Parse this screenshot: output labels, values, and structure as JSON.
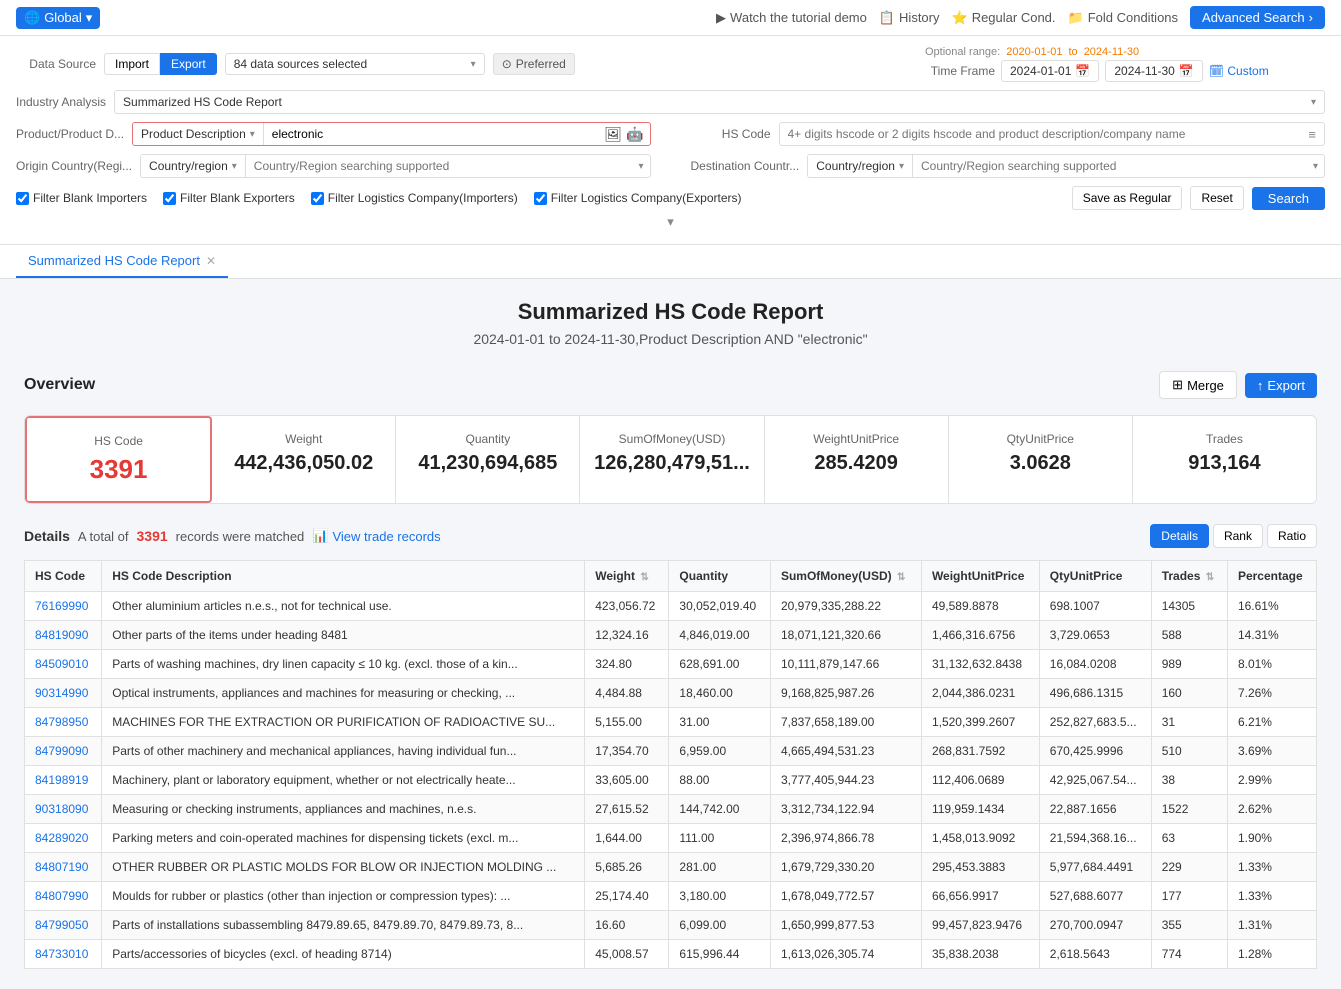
{
  "topNav": {
    "globalLabel": "Global",
    "tutorialLabel": "Watch the tutorial demo",
    "historyLabel": "History",
    "regularCondLabel": "Regular Cond.",
    "foldCondLabel": "Fold Conditions",
    "advancedSearchLabel": "Advanced Search"
  },
  "searchForm": {
    "dataSourceLabel": "Data Source",
    "importLabel": "Import",
    "exportLabel": "Export",
    "dataSourcesSelected": "84 data sources selected",
    "preferredLabel": "Preferred",
    "optionalRange": "Optional range:",
    "dateRangeStart": "2020-01-01",
    "dateRangeEnd": "2024-11-30",
    "timeFrameLabel": "Time Frame",
    "timeFrameStart": "2024-01-01",
    "timeFrameEnd": "2024-11-30",
    "customLabel": "Custom",
    "industryAnalysisLabel": "Industry Analysis",
    "industryValue": "Summarized HS Code Report",
    "productLabel": "Product/Product D...",
    "productTypeLabel": "Product Description",
    "productValue": "electronic",
    "hsCodeLabel": "HS Code",
    "hsCodePlaceholder": "4+ digits hscode or 2 digits hscode and product description/company name",
    "originCountryLabel": "Origin Country(Regi...",
    "originCountryType": "Country/region",
    "originCountryPlaceholder": "Country/Region searching supported",
    "destCountryLabel": "Destination Countr...",
    "destCountryType": "Country/region",
    "destCountryPlaceholder": "Country/Region searching supported",
    "checkboxes": [
      "Filter Blank Importers",
      "Filter Blank Exporters",
      "Filter Logistics Company(Importers)",
      "Filter Logistics Company(Exporters)"
    ],
    "saveRegularLabel": "Save as Regular",
    "resetLabel": "Reset",
    "searchLabel": "Search"
  },
  "resultTab": {
    "label": "Summarized HS Code Report"
  },
  "report": {
    "title": "Summarized HS Code Report",
    "subtitle": "2024-01-01 to 2024-11-30,Product Description AND \"electronic\""
  },
  "overview": {
    "title": "Overview",
    "mergeLabel": "Merge",
    "exportLabel": "Export",
    "stats": [
      {
        "label": "HS Code",
        "value": "3391",
        "highlight": true
      },
      {
        "label": "Weight",
        "value": "442,436,050.02"
      },
      {
        "label": "Quantity",
        "value": "41,230,694,685"
      },
      {
        "label": "SumOfMoney(USD)",
        "value": "126,280,479,51..."
      },
      {
        "label": "WeightUnitPrice",
        "value": "285.4209"
      },
      {
        "label": "QtyUnitPrice",
        "value": "3.0628"
      },
      {
        "label": "Trades",
        "value": "913,164"
      }
    ]
  },
  "details": {
    "title": "Details",
    "totalPrefix": "A total of",
    "totalCount": "3391",
    "totalSuffix": "records were matched",
    "viewTradeLabel": "View trade records",
    "tabs": [
      "Details",
      "Rank",
      "Ratio"
    ],
    "activeTab": "Details",
    "columns": [
      "HS Code",
      "HS Code Description",
      "Weight",
      "Quantity",
      "SumOfMoney(USD)",
      "WeightUnitPrice",
      "QtyUnitPrice",
      "Trades",
      "Percentage"
    ],
    "rows": [
      {
        "hscode": "76169990",
        "desc": "Other aluminium articles n.e.s., not for technical use.",
        "weight": "423,056.72",
        "qty": "30,052,019.40",
        "sum": "20,979,335,288.22",
        "wup": "49,589.8878",
        "qup": "698.1007",
        "trades": "14305",
        "pct": "16.61%"
      },
      {
        "hscode": "84819090",
        "desc": "Other parts of the items under heading 8481",
        "weight": "12,324.16",
        "qty": "4,846,019.00",
        "sum": "18,071,121,320.66",
        "wup": "1,466,316.6756",
        "qup": "3,729.0653",
        "trades": "588",
        "pct": "14.31%"
      },
      {
        "hscode": "84509010",
        "desc": "Parts of washing machines, dry linen capacity ≤ 10 kg. (excl. those of a kin...",
        "weight": "324.80",
        "qty": "628,691.00",
        "sum": "10,111,879,147.66",
        "wup": "31,132,632.8438",
        "qup": "16,084.0208",
        "trades": "989",
        "pct": "8.01%"
      },
      {
        "hscode": "90314990",
        "desc": "Optical instruments, appliances and machines for measuring or checking, ...",
        "weight": "4,484.88",
        "qty": "18,460.00",
        "sum": "9,168,825,987.26",
        "wup": "2,044,386.0231",
        "qup": "496,686.1315",
        "trades": "160",
        "pct": "7.26%"
      },
      {
        "hscode": "84798950",
        "desc": "MACHINES FOR THE EXTRACTION OR PURIFICATION OF RADIOACTIVE SU...",
        "weight": "5,155.00",
        "qty": "31.00",
        "sum": "7,837,658,189.00",
        "wup": "1,520,399.2607",
        "qup": "252,827,683.5...",
        "trades": "31",
        "pct": "6.21%"
      },
      {
        "hscode": "84799090",
        "desc": "Parts of other machinery and mechanical appliances, having individual fun...",
        "weight": "17,354.70",
        "qty": "6,959.00",
        "sum": "4,665,494,531.23",
        "wup": "268,831.7592",
        "qup": "670,425.9996",
        "trades": "510",
        "pct": "3.69%"
      },
      {
        "hscode": "84198919",
        "desc": "Machinery, plant or laboratory equipment, whether or not electrically heate...",
        "weight": "33,605.00",
        "qty": "88.00",
        "sum": "3,777,405,944.23",
        "wup": "112,406.0689",
        "qup": "42,925,067.54...",
        "trades": "38",
        "pct": "2.99%"
      },
      {
        "hscode": "90318090",
        "desc": "Measuring or checking instruments, appliances and machines, n.e.s.",
        "weight": "27,615.52",
        "qty": "144,742.00",
        "sum": "3,312,734,122.94",
        "wup": "119,959.1434",
        "qup": "22,887.1656",
        "trades": "1522",
        "pct": "2.62%"
      },
      {
        "hscode": "84289020",
        "desc": "Parking meters and coin-operated machines for dispensing tickets (excl. m...",
        "weight": "1,644.00",
        "qty": "111.00",
        "sum": "2,396,974,866.78",
        "wup": "1,458,013.9092",
        "qup": "21,594,368.16...",
        "trades": "63",
        "pct": "1.90%"
      },
      {
        "hscode": "84807190",
        "desc": "OTHER RUBBER OR PLASTIC MOLDS FOR BLOW OR INJECTION MOLDING ...",
        "weight": "5,685.26",
        "qty": "281.00",
        "sum": "1,679,729,330.20",
        "wup": "295,453.3883",
        "qup": "5,977,684.4491",
        "trades": "229",
        "pct": "1.33%"
      },
      {
        "hscode": "84807990",
        "desc": "Moulds for rubber or plastics (other than injection or compression types): ...",
        "weight": "25,174.40",
        "qty": "3,180.00",
        "sum": "1,678,049,772.57",
        "wup": "66,656.9917",
        "qup": "527,688.6077",
        "trades": "177",
        "pct": "1.33%"
      },
      {
        "hscode": "84799050",
        "desc": "Parts of installations subassembling 8479.89.65, 8479.89.70, 8479.89.73, 8...",
        "weight": "16.60",
        "qty": "6,099.00",
        "sum": "1,650,999,877.53",
        "wup": "99,457,823.9476",
        "qup": "270,700.0947",
        "trades": "355",
        "pct": "1.31%"
      },
      {
        "hscode": "84733010",
        "desc": "Parts/accessories of bicycles (excl. of heading 8714)",
        "weight": "45,008.57",
        "qty": "615,996.44",
        "sum": "1,613,026,305.74",
        "wup": "35,838.2038",
        "qup": "2,618.5643",
        "trades": "774",
        "pct": "1.28%"
      }
    ]
  }
}
